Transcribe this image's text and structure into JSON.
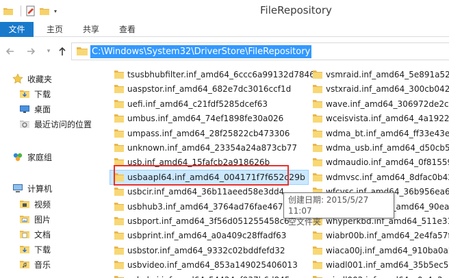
{
  "window": {
    "title": "FileRepository"
  },
  "ribbon": {
    "tabs": [
      "文件",
      "主页",
      "共享",
      "查看"
    ]
  },
  "address": {
    "path": "C:\\Windows\\System32\\DriverStore\\FileRepository"
  },
  "navpane": {
    "favorites": "收藏夹",
    "fav_items": [
      "下载",
      "桌面",
      "最近访问的位置"
    ],
    "homegroup": "家庭组",
    "computer": "计算机",
    "computer_items": [
      "视频",
      "图片",
      "文档",
      "下载",
      "音乐"
    ]
  },
  "files": {
    "column1": [
      "tsusbhubfilter.inf_amd64_6ccc6a99132d7846",
      "uaspstor.inf_amd64_682e7dc3016ccf1d",
      "uefi.inf_amd64_c21fdf5285dcef63",
      "umbus.inf_amd64_74ef1898fe30a026",
      "umpass.inf_amd64_28f25822cb473306",
      "unknown.inf_amd64_23354a24a873cb77",
      "usb.inf_amd64_15fafcb2a918626b",
      "usbaapl64.inf_amd64_004171f7f652c29b",
      "usbcir.inf_amd64_36b11aeed58e3dd4",
      "usbhub3.inf_amd64_3764ad76fae467bc",
      "usbport.inf_amd64_3f56d051255458c6",
      "usbprint.inf_amd64_a0a409c28ffadf63",
      "usbstor.inf_amd64_9332c02bddfefd32",
      "usbvideo.inf_amd64_853a149025406013",
      "usbxhci.inf_amd64_54424af937b6d845"
    ],
    "column2": [
      "vsmraid.inf_amd64_5e891a5235",
      "vstxraid.inf_amd64_300cb04282",
      "wave.inf_amd64_306972de2c32",
      "wceisvista.inf_amd64_4a19223e",
      "wdma_bt.inf_amd64_ff33e43ec6",
      "wdma_usb.inf_amd64_d50cb57f",
      "wdmaudio.inf_amd64_0f81559c",
      "wdmvsc.inf_amd64_8dfac0b424",
      "wfcvsc.inf_amd64_36b956ea651",
      "wgencounter.inf_amd64_90ead5",
      "whyperkbd.inf_amd64_511e313",
      "wiabr00b.inf_amd64_2e4fa57f",
      "wiaca00j.inf_amd64_910ba0a25",
      "wiadl001.inf_amd64_35b5ec5e9",
      "wiadl002.inf_amd64_c0c4e2aa55"
    ]
  },
  "tooltip": {
    "line1": "创建日期: 2015/5/27 11:07",
    "line2": "空文件夹"
  }
}
